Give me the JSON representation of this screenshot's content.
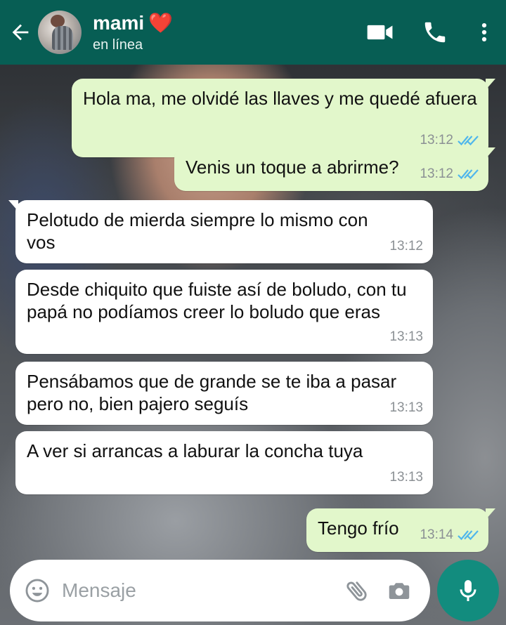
{
  "header": {
    "contact_name": "mami",
    "heart_emoji": "❤️",
    "status": "en línea",
    "icons": [
      "back-arrow-icon",
      "video-call-icon",
      "phone-icon",
      "more-vert-icon"
    ]
  },
  "messages": [
    {
      "direction": "out",
      "text": "Hola ma, me olvidé las llaves y me quedé afuera",
      "time": "13:12",
      "read": true
    },
    {
      "direction": "out",
      "text": "Venis un toque a abrirme?",
      "time": "13:12",
      "read": true
    },
    {
      "direction": "in",
      "text": "Pelotudo de mierda siempre lo mismo con vos",
      "time": "13:12"
    },
    {
      "direction": "in",
      "text": "Desde chiquito que fuiste así de boludo, con tu papá no podíamos creer lo boludo que eras",
      "time": "13:13"
    },
    {
      "direction": "in",
      "text": "Pensábamos que de grande se te iba a pasar pero no, bien pajero seguís",
      "time": "13:13"
    },
    {
      "direction": "in",
      "text": "A ver si arrancas a laburar la concha tuya",
      "time": "13:13"
    },
    {
      "direction": "out",
      "text": "Tengo frío",
      "time": "13:14",
      "read": true
    }
  ],
  "input": {
    "placeholder": "Mensaje",
    "icons": [
      "emoji-icon",
      "attach-icon",
      "camera-icon",
      "mic-icon"
    ]
  },
  "colors": {
    "header_bg": "#075e54",
    "outgoing_bubble": "#e2f7cb",
    "incoming_bubble": "#ffffff",
    "read_ticks": "#4fb6ec",
    "mic_button": "#128c7e"
  }
}
